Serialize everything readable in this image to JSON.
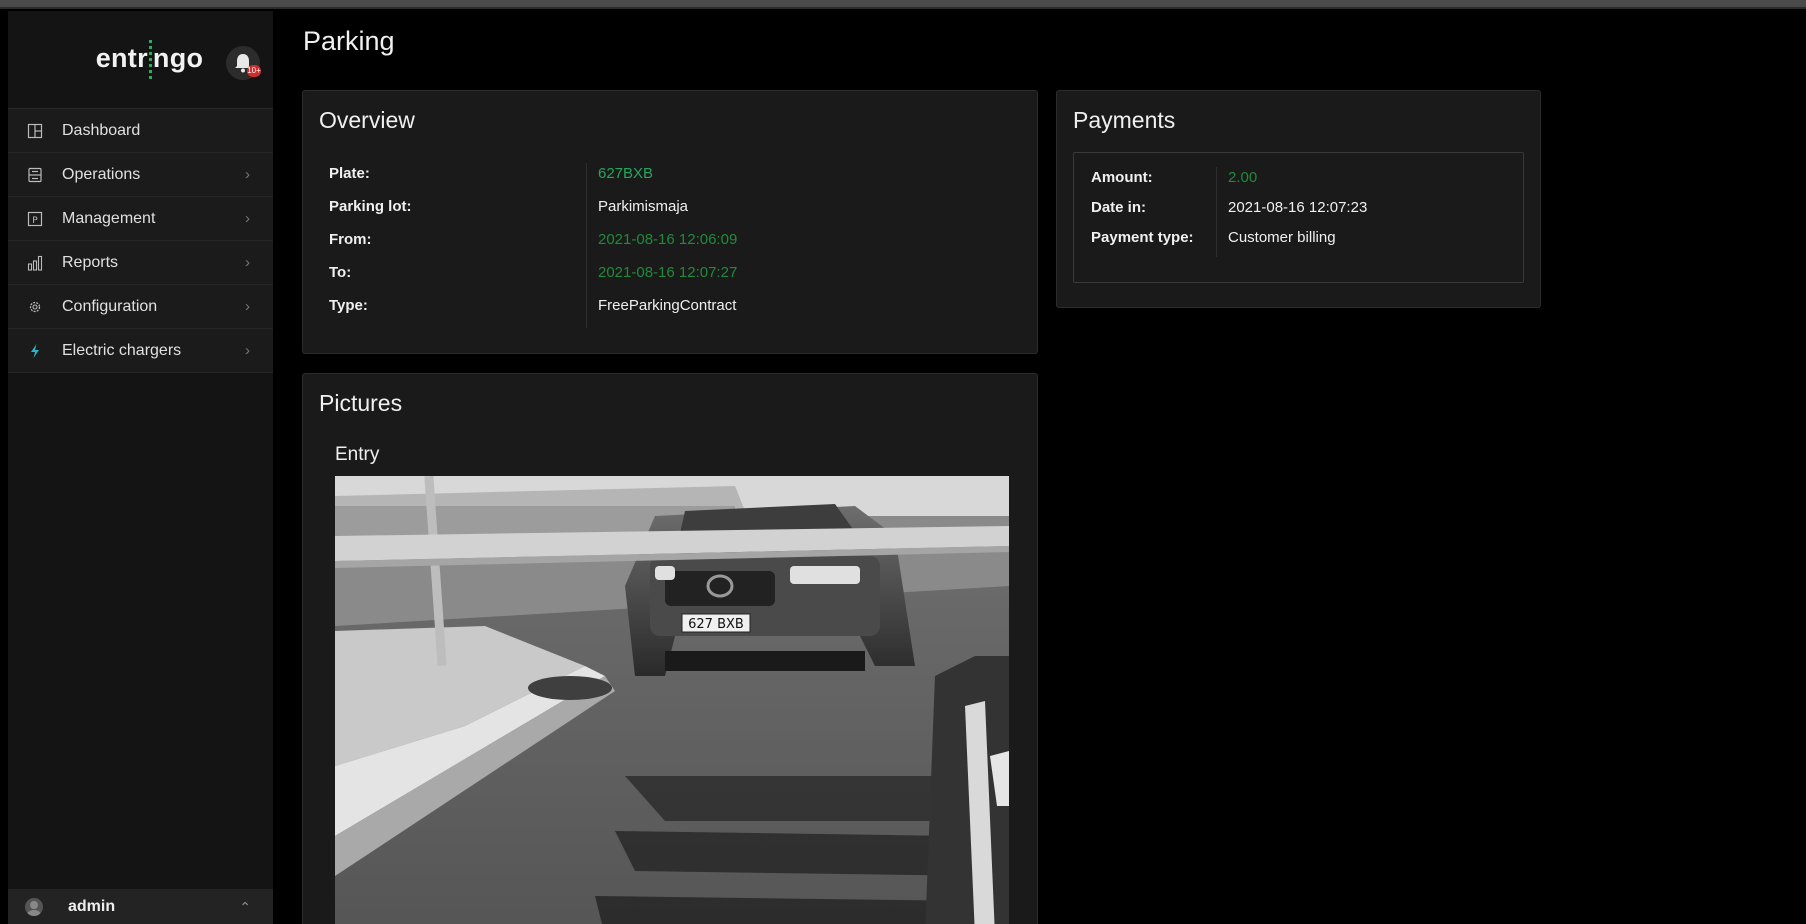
{
  "brand": {
    "logo_text_pre": "entr",
    "logo_text_post": "ngo",
    "notification_badge": "10+"
  },
  "sidebar": {
    "items": [
      {
        "label": "Dashboard",
        "icon": "dashboard-icon",
        "has_children": false
      },
      {
        "label": "Operations",
        "icon": "operations-icon",
        "has_children": true
      },
      {
        "label": "Management",
        "icon": "parking-p-icon",
        "has_children": true
      },
      {
        "label": "Reports",
        "icon": "bar-chart-icon",
        "has_children": true
      },
      {
        "label": "Configuration",
        "icon": "gear-icon",
        "has_children": true
      },
      {
        "label": "Electric chargers",
        "icon": "lightning-icon",
        "has_children": true
      }
    ],
    "user": {
      "name": "admin"
    }
  },
  "page": {
    "title": "Parking"
  },
  "overview": {
    "title": "Overview",
    "rows": [
      {
        "key": "Plate:",
        "value": "627BXB"
      },
      {
        "key": "Parking lot:",
        "value": "Parkimismaja"
      },
      {
        "key": "From:",
        "value": "2021-08-16 12:06:09"
      },
      {
        "key": "To:",
        "value": "2021-08-16 12:07:27"
      },
      {
        "key": "Type:",
        "value": "FreeParkingContract"
      }
    ]
  },
  "payments": {
    "title": "Payments",
    "rows": [
      {
        "key": "Amount:",
        "value": "2.00"
      },
      {
        "key": "Date in:",
        "value": "2021-08-16 12:07:23"
      },
      {
        "key": "Payment type:",
        "value": "Customer billing"
      }
    ]
  },
  "pictures": {
    "title": "Pictures",
    "entry_label": "Entry",
    "plate_text": "627 BXB"
  },
  "colors": {
    "accent_green": "#26a65b",
    "value_green": "#1f8b3a",
    "bg": "#000000",
    "card": "#1a1a1a",
    "lightning": "#2bb3c9"
  }
}
